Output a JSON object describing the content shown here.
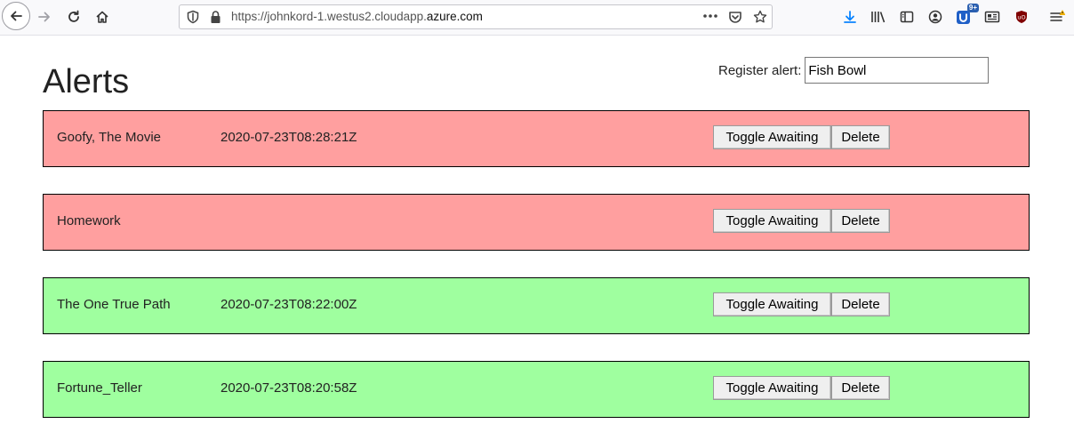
{
  "browser": {
    "url_prefix": "https://johnkord-1.westus2.cloudapp.",
    "url_domain": "azure.com",
    "extension_badge": "9+"
  },
  "page": {
    "title": "Alerts",
    "register_label": "Register alert:",
    "register_value": "Fish Bowl"
  },
  "alerts": [
    {
      "name": "Goofy, The Movie",
      "time": "2020-07-23T08:28:21Z",
      "color": "#ff9f9f",
      "toggle_label": "Toggle Awaiting",
      "delete_label": "Delete"
    },
    {
      "name": "Homework",
      "time": "",
      "color": "#ff9f9f",
      "toggle_label": "Toggle Awaiting",
      "delete_label": "Delete"
    },
    {
      "name": "The One True Path",
      "time": "2020-07-23T08:22:00Z",
      "color": "#9fff9f",
      "toggle_label": "Toggle Awaiting",
      "delete_label": "Delete"
    },
    {
      "name": "Fortune_Teller",
      "time": "2020-07-23T08:20:58Z",
      "color": "#9fff9f",
      "toggle_label": "Toggle Awaiting",
      "delete_label": "Delete"
    }
  ]
}
